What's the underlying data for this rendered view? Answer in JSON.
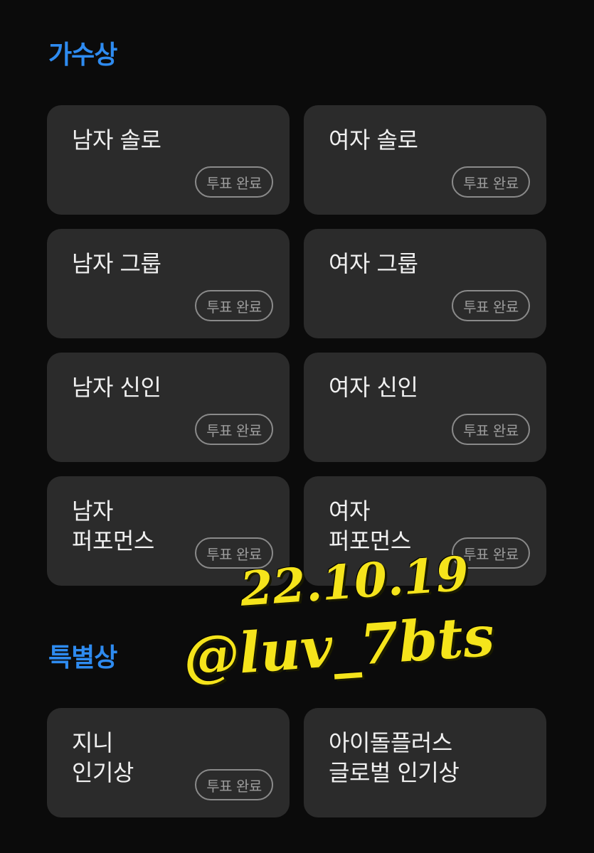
{
  "sections": {
    "singer": {
      "title": "가수상",
      "cards": [
        {
          "label": "남자 솔로",
          "badge": "투표 완료"
        },
        {
          "label": "여자 솔로",
          "badge": "투표 완료"
        },
        {
          "label": "남자 그룹",
          "badge": "투표 완료"
        },
        {
          "label": "여자 그룹",
          "badge": "투표 완료"
        },
        {
          "label": "남자 신인",
          "badge": "투표 완료"
        },
        {
          "label": "여자 신인",
          "badge": "투표 완료"
        },
        {
          "label": "남자\n퍼포먼스",
          "badge": "투표 완료"
        },
        {
          "label": "여자\n퍼포먼스",
          "badge": "투표 완료"
        }
      ]
    },
    "special": {
      "title": "특별상",
      "cards": [
        {
          "label": "지니\n인기상",
          "badge": "투표 완료"
        },
        {
          "label": "아이돌플러스\n글로벌 인기상"
        }
      ]
    }
  },
  "watermark": {
    "date": "22.10.19",
    "handle": "@luv_7bts"
  },
  "colors": {
    "accent": "#2e8bf0",
    "card_bg": "#2b2b2b",
    "watermark": "#f5e41b"
  }
}
